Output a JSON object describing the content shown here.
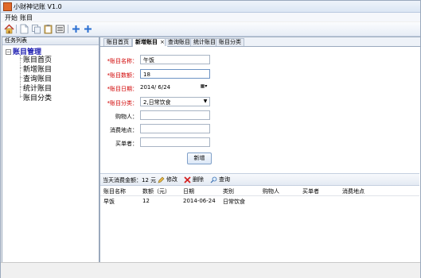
{
  "window": {
    "title": "小财神记账 V1.0"
  },
  "menu": [
    "开始",
    "账目"
  ],
  "left": {
    "header": "任务列表",
    "root": "账目管理",
    "items": [
      "账目首页",
      "新增账目",
      "查询账目",
      "统计账目",
      "账目分类"
    ]
  },
  "tabs": [
    {
      "label": "账目首页"
    },
    {
      "label": "新增账目",
      "close": "×"
    },
    {
      "label": "查询账目"
    },
    {
      "label": "统计账目"
    },
    {
      "label": "账目分类"
    }
  ],
  "form": {
    "name_label": "*账目名称：",
    "name_value": "午饭",
    "amount_label": "*账目数额：",
    "amount_value": "18",
    "date_label": "*账目日期：",
    "date_value": "2014/  6/24",
    "category_label": "*账目分类：",
    "category_value": "2,日常饮食",
    "buyer_label": "购物人：",
    "place_label": "消费地点：",
    "payer_label": "买单者：",
    "add_button": "新增"
  },
  "grid": {
    "summary": "当天消费金额：12 元",
    "actions": {
      "edit": "修改",
      "delete": "删除",
      "query": "查询"
    },
    "columns": [
      "账目名称",
      "数额（元）",
      "日期",
      "类别",
      "购物人",
      "买单者",
      "消费地点"
    ],
    "rows": [
      [
        "早饭",
        "12",
        "2014-06-24",
        "日常饮食",
        "",
        "",
        ""
      ]
    ]
  },
  "colors": {
    "required": "#d00000",
    "tree_root": "#1a1ab0",
    "border": "#9aa9bd"
  }
}
